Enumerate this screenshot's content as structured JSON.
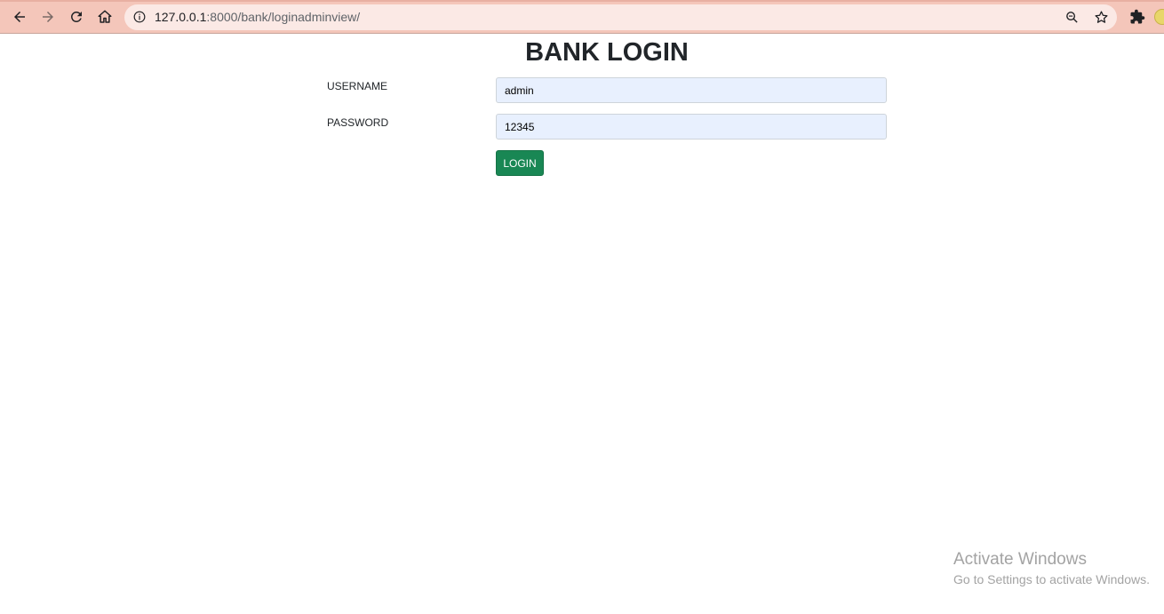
{
  "browser": {
    "url_host": "127.0.0.1",
    "url_path": ":8000/bank/loginadminview/",
    "icons": [
      "back-icon",
      "forward-icon",
      "reload-icon",
      "home-icon",
      "info-icon",
      "zoom-icon",
      "star-icon",
      "extensions-icon",
      "profile-avatar"
    ]
  },
  "page": {
    "title": "BANK LOGIN"
  },
  "form": {
    "username_label": "USERNAME",
    "username_value": "admin",
    "password_label": "PASSWORD",
    "password_value": "12345",
    "login_label": "LOGIN",
    "button_color": "#198754",
    "input_fill_color": "#e8f0fe"
  },
  "watermark": {
    "title": "Activate Windows",
    "subtitle": "Go to Settings to activate Windows."
  }
}
